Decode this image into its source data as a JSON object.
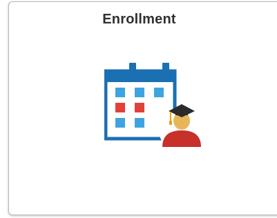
{
  "tile": {
    "title": "Enrollment",
    "icon": "calendar-graduate-icon"
  },
  "colors": {
    "calendar_blue": "#1b6fb3",
    "cell_light_blue": "#3fa3e0",
    "cell_red": "#e2413a",
    "face_skin": "#e8b65a",
    "gown_red": "#c8302a",
    "cap_dark": "#2b2b2b",
    "tassel_gold": "#e8a317"
  }
}
